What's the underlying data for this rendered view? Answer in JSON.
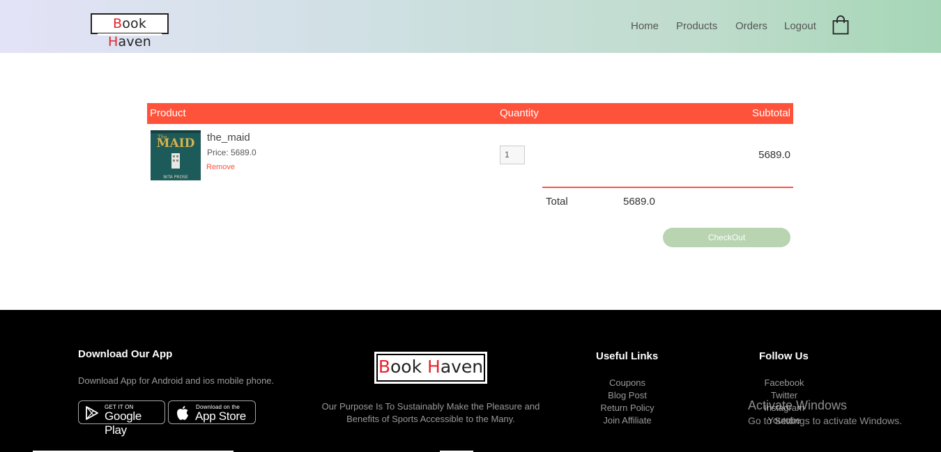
{
  "header": {
    "logo": {
      "part1": "B",
      "part2": "ook ",
      "part3": "H",
      "part4": "aven"
    },
    "nav": [
      "Home",
      "Products",
      "Orders",
      "Logout"
    ],
    "cart_icon": "shopping-bag-icon"
  },
  "cart": {
    "columns": {
      "product": "Product",
      "quantity": "Quantity",
      "subtotal": "Subtotal"
    },
    "items": [
      {
        "name": "the_maid",
        "price": "Price: 5689.0",
        "remove": "Remove",
        "quantity": "1",
        "subtotal": "5689.0"
      }
    ],
    "total_label": "Total",
    "total_value": "5689.0",
    "checkout": "CheckOut"
  },
  "footer": {
    "download": {
      "title": "Download Our App",
      "text": "Download App for Android and ios mobile phone.",
      "google": {
        "small": "GET IT ON",
        "large": "Google Play"
      },
      "apple": {
        "small": "Download on the",
        "large": "App Store"
      }
    },
    "brand": {
      "logo": {
        "part1": "B",
        "part2": "ook ",
        "part3": "H",
        "part4": "aven"
      },
      "line1": "Our Purpose Is To Sustainably Make the Pleasure and",
      "line2": "Benefits of Sports Accessible to the Many."
    },
    "useful_links": {
      "title": "Useful Links",
      "items": [
        "Coupons",
        "Blog Post",
        "Return Policy",
        "Join Affiliate"
      ]
    },
    "follow_us": {
      "title": "Follow Us",
      "items": [
        "Facebook",
        "Twitter",
        "Instagram",
        "Youtube"
      ]
    }
  },
  "overlay": {
    "activate_title": "Activate Windows",
    "activate_text": "Go to Settings to activate Windows."
  },
  "colors": {
    "accent": "#ff523b",
    "checkout": "#b8d4b0",
    "footer_bg": "#000000"
  }
}
